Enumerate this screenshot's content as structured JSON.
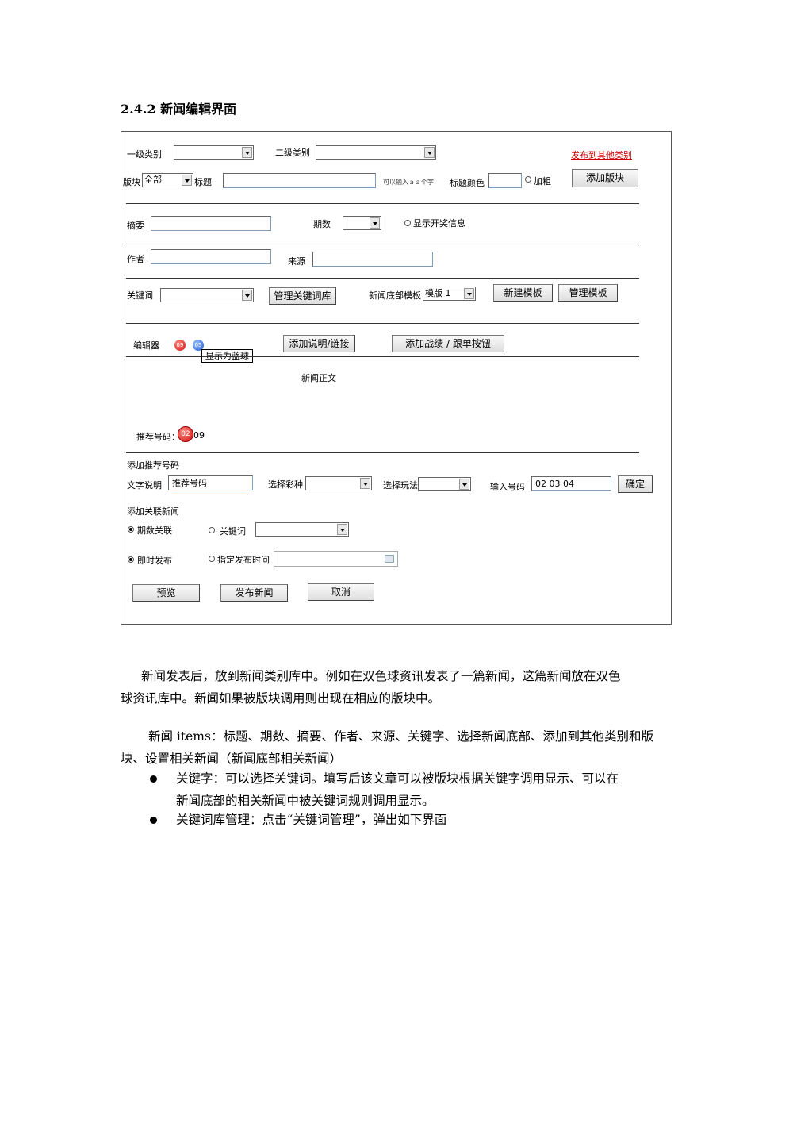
{
  "section_title": "2.4.2 新闻编辑界面",
  "form": {
    "category1_label": "一级类别",
    "category2_label": "二级类别",
    "publish_other_link": "发布到其他类别",
    "block_label": "版块",
    "block_value": "全部",
    "title_label": "标题",
    "title_hint": "可以输入ａａ个字",
    "title_color_label": "标题颜色",
    "bold_label": "加粗",
    "add_block_button": "添加版块",
    "summary_label": "摘要",
    "issue_label": "期数",
    "show_lottery_label": "显示开奖信息",
    "author_label": "作者",
    "source_label": "来源",
    "keyword_label": "关键词",
    "manage_keywords_button": "管理关键词库",
    "footer_template_label": "新闻底部模板",
    "footer_template_value": "模版 1",
    "new_template_button": "新建模板",
    "manage_template_button": "管理模板",
    "editor_label": "编辑器",
    "red_ball": "09",
    "blue_ball": "05",
    "tooltip": "显示为蓝球",
    "add_desc_button": "添加说明/链接",
    "add_record_button": "添加战绩 / 跟单按钮",
    "body_label": "新闻正文",
    "recommend_label": "推荐号码：",
    "recommend_ball": "02",
    "recommend_extra": "09",
    "add_recommend_label": "添加推荐号码",
    "text_desc_label": "文字说明",
    "text_desc_value": "推荐号码",
    "lottery_type_label": "选择彩种",
    "play_type_label": "选择玩法",
    "input_numbers_label": "输入号码",
    "input_numbers_value": "02 03 04",
    "confirm_button": "确定",
    "related_news_label": "添加关联新闻",
    "issue_related_label": "期数关联",
    "keyword_related_label": "关键词",
    "publish_now_label": "即时发布",
    "scheduled_label": "指定发布时间",
    "preview_button": "预览",
    "publish_button": "发布新闻",
    "cancel_button": "取消"
  },
  "paragraphs": [
    "新闻发表后，放到新闻类别库中。例如在双色球资讯发表了一篇新闻，这篇新闻放在双色",
    "球资讯库中。新闻如果被版块调用则出现在相应的版块中。",
    "新闻 items：标题、期数、摘要、作者、来源、关键字、选择新闻底部、添加到其他类别和版",
    "块、设置相关新闻（新闻底部相关新闻）"
  ],
  "bullets": [
    {
      "line1": "关键字：可以选择关键词。填写后该文章可以被版块根据关键字调用显示、可以在",
      "line2": "新闻底部的相关新闻中被关键词规则调用显示。"
    },
    {
      "line1": "关键词库管理：点击“关键词管理”，弹出如下界面",
      "line2": ""
    }
  ]
}
